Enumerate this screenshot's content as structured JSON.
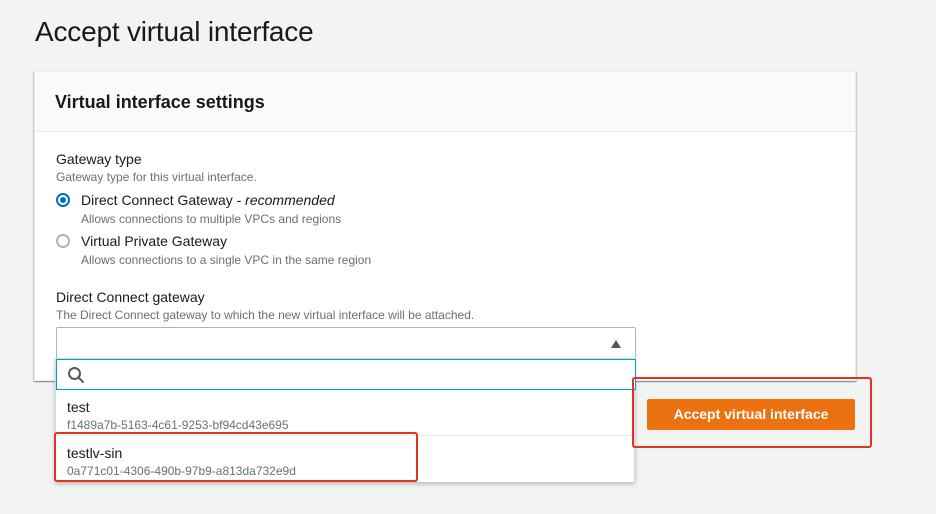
{
  "page": {
    "title": "Accept virtual interface"
  },
  "panel": {
    "title": "Virtual interface settings",
    "gateway_type": {
      "label": "Gateway type",
      "description": "Gateway type for this virtual interface.",
      "options": [
        {
          "label": "Direct Connect Gateway - ",
          "label_suffix": "recommended",
          "description": "Allows connections to multiple VPCs and regions",
          "selected": true
        },
        {
          "label": "Virtual Private Gateway",
          "description": "Allows connections to a single VPC in the same region",
          "selected": false
        }
      ]
    },
    "dc_gateway": {
      "label": "Direct Connect gateway",
      "description": "The Direct Connect gateway to which the new virtual interface will be attached.",
      "value": "",
      "search_value": "",
      "options": [
        {
          "label": "test",
          "id": "f1489a7b-5163-4c61-9253-bf94cd43e695"
        },
        {
          "label": "testlv-sin",
          "id": "0a771c01-4306-490b-97b9-a813da732e9d"
        }
      ]
    }
  },
  "actions": {
    "accept_label": "Accept virtual interface"
  },
  "colors": {
    "accent_orange": "#ec7211",
    "selected_blue": "#0073bb",
    "focus_cyan": "#00a1c9",
    "annotation_red": "#e3321e"
  }
}
